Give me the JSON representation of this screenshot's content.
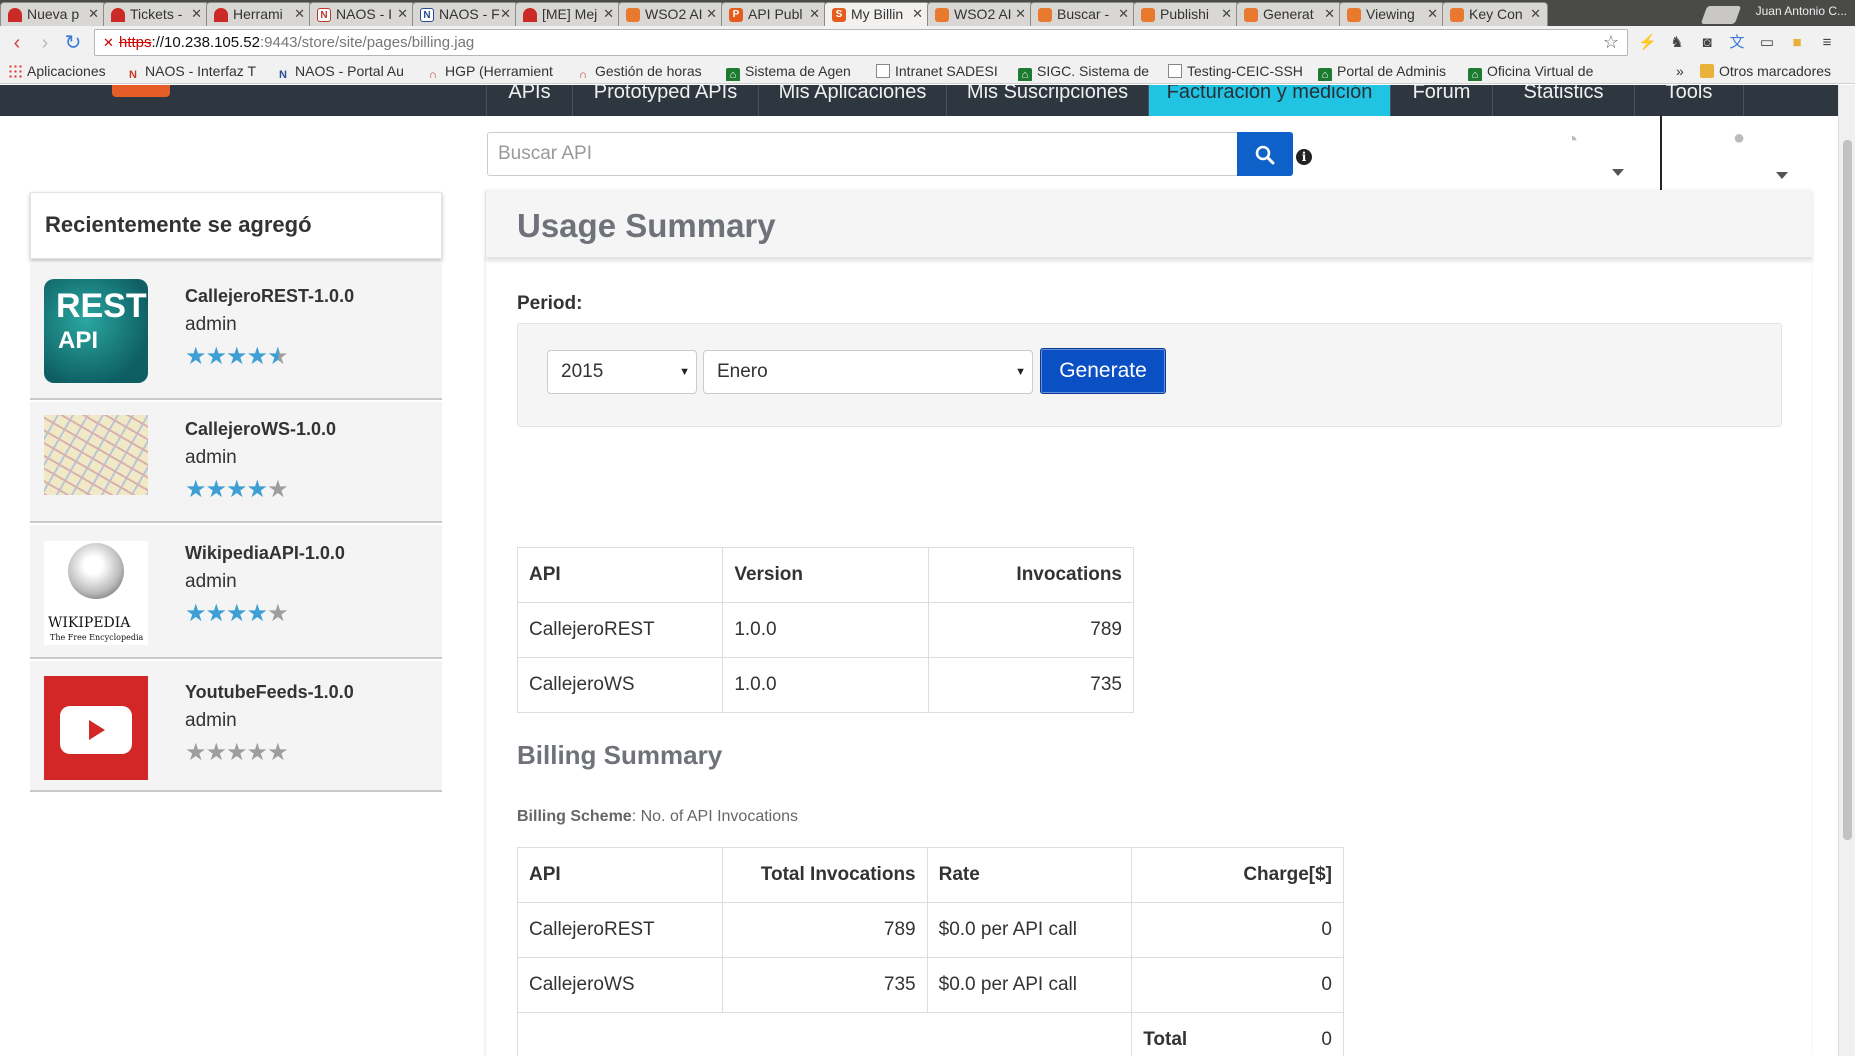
{
  "browser": {
    "tabs": [
      {
        "label": "Nueva p",
        "icon": "hg-icon"
      },
      {
        "label": "Tickets -",
        "icon": "hg-icon"
      },
      {
        "label": "Herrami",
        "icon": "hg-icon"
      },
      {
        "label": "NAOS - I",
        "icon": "naos-icon"
      },
      {
        "label": "NAOS - F",
        "icon": "naos-icon"
      },
      {
        "label": "[ME] Mej",
        "icon": "hg-icon"
      },
      {
        "label": "WSO2 AI",
        "icon": "wso2-icon"
      },
      {
        "label": "API Publ",
        "icon": "api-publisher-icon"
      },
      {
        "label": "My Billin",
        "icon": "api-store-icon",
        "active": true
      },
      {
        "label": "WSO2 AI",
        "icon": "wso2-icon"
      },
      {
        "label": "Buscar -",
        "icon": "wso2-icon"
      },
      {
        "label": "Publishi",
        "icon": "wso2-icon"
      },
      {
        "label": "Generat",
        "icon": "wso2-icon"
      },
      {
        "label": "Viewing",
        "icon": "wso2-icon"
      },
      {
        "label": "Key Con",
        "icon": "wso2-icon"
      }
    ],
    "user": "Juan Antonio C...",
    "url": {
      "scheme": "https",
      "host": "://10.238.105.52",
      "path": ":9443/store/site/pages/billing.jag"
    },
    "bookmarks": [
      {
        "label": "Aplicaciones",
        "icon": "apps-grid-icon"
      },
      {
        "label": "NAOS - Interfaz T",
        "icon": "naos-icon"
      },
      {
        "label": "NAOS - Portal Au",
        "icon": "naos-icon"
      },
      {
        "label": "HGP (Herramient",
        "icon": "hg-icon"
      },
      {
        "label": "Gestión de horas",
        "icon": "hg-icon"
      },
      {
        "label": "Sistema de Agen",
        "icon": "junta-icon"
      },
      {
        "label": "Intranet SADESI",
        "icon": "document-icon"
      },
      {
        "label": "SIGC. Sistema de",
        "icon": "junta-icon"
      },
      {
        "label": "Testing-CEIC-SSH",
        "icon": "document-icon"
      },
      {
        "label": "Portal de Adminis",
        "icon": "junta-icon"
      },
      {
        "label": "Oficina Virtual de",
        "icon": "junta-icon"
      }
    ],
    "bookmarks_more": "»",
    "other_bookmarks": "Otros marcadores"
  },
  "nav": {
    "items": [
      "APIs",
      "Prototyped APIs",
      "Mis Aplicaciones",
      "Mis Suscripciones",
      "Facturación y medición",
      "Forum",
      "Statistics",
      "Tools"
    ],
    "active": "Facturación y medición"
  },
  "search": {
    "placeholder": "Buscar API"
  },
  "sidebar": {
    "title": "Recientemente se agregó",
    "items": [
      {
        "name": "CallejeroREST-1.0.0",
        "owner": "admin",
        "rating": 4.5,
        "thumb_text": [
          "REST",
          "API"
        ]
      },
      {
        "name": "CallejeroWS-1.0.0",
        "owner": "admin",
        "rating": 4,
        "thumb": "map"
      },
      {
        "name": "WikipediaAPI-1.0.0",
        "owner": "admin",
        "rating": 4,
        "thumb_text": [
          "WIKIPEDIA",
          "The Free Encyclopedia"
        ]
      },
      {
        "name": "YoutubeFeeds-1.0.0",
        "owner": "admin",
        "rating": 0,
        "thumb": "youtube"
      }
    ]
  },
  "usage": {
    "title": "Usage Summary",
    "period_label": "Period:",
    "year": "2015",
    "month": "Enero",
    "generate": "Generate",
    "table": {
      "headers": [
        "API",
        "Version",
        "Invocations"
      ],
      "rows": [
        [
          "CallejeroREST",
          "1.0.0",
          "789"
        ],
        [
          "CallejeroWS",
          "1.0.0",
          "735"
        ]
      ]
    }
  },
  "billing": {
    "title": "Billing Summary",
    "scheme_label": "Billing Scheme",
    "scheme_value": ": No. of API Invocations",
    "table": {
      "headers": [
        "API",
        "Total Invocations",
        "Rate",
        "Charge[$]"
      ],
      "rows": [
        [
          "CallejeroREST",
          "789",
          "$0.0 per API call",
          "0"
        ],
        [
          "CallejeroWS",
          "735",
          "$0.0 per API call",
          "0"
        ]
      ],
      "total_label": "Total",
      "total_value": "0"
    }
  },
  "colors": {
    "nav_bg": "#2e3740",
    "nav_active": "#20c3e1",
    "button_blue": "#0b4fc4",
    "star_blue": "#3d9fd4"
  }
}
